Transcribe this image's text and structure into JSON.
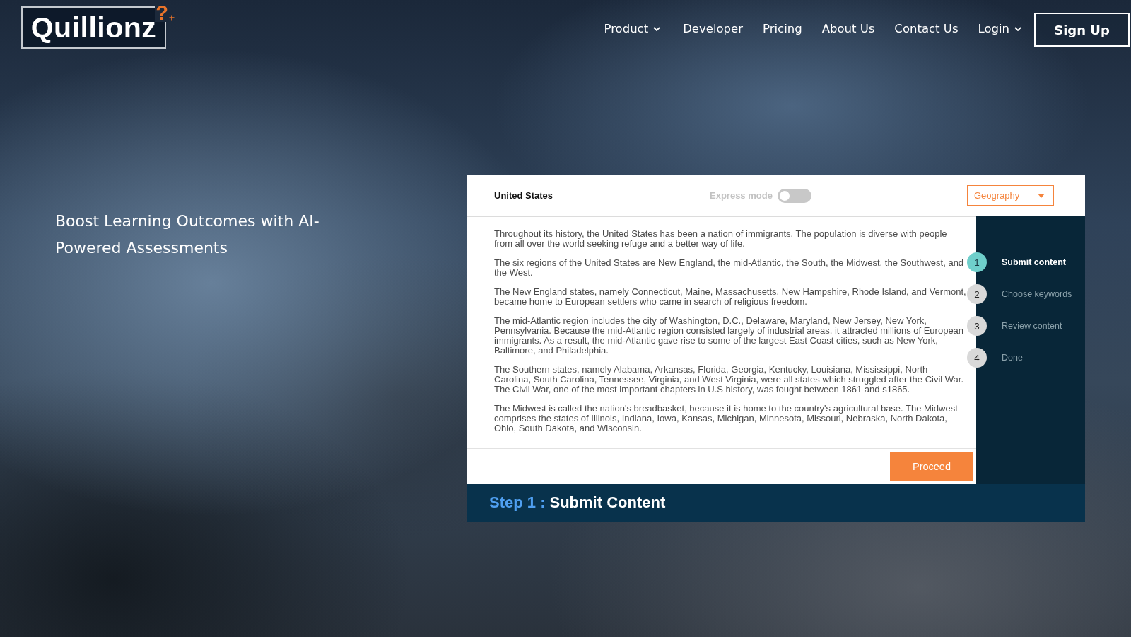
{
  "logo": {
    "wordmark": "Quillionz",
    "mark": "?"
  },
  "nav": {
    "items": [
      {
        "label": "Product",
        "dropdown": true
      },
      {
        "label": "Developer",
        "dropdown": false
      },
      {
        "label": "Pricing",
        "dropdown": false
      },
      {
        "label": "About Us",
        "dropdown": false
      },
      {
        "label": "Contact Us",
        "dropdown": false
      },
      {
        "label": "Login",
        "dropdown": true
      }
    ],
    "signup": "Sign Up"
  },
  "hero": {
    "headline": "Boost Learning Outcomes with AI-Powered Assessments"
  },
  "panel": {
    "header": {
      "title": "United States",
      "express_mode": {
        "label": "Express mode",
        "on": false
      },
      "category": {
        "value": "Geography"
      }
    },
    "paragraphs": [
      "Throughout its history, the United States has been a nation of immigrants. The population is diverse with people from all over the world seeking refuge and a better way of life.",
      "The six regions of the United States are New England, the mid-Atlantic, the South, the Midwest, the Southwest, and the West.",
      "The New England states, namely Connecticut, Maine, Massachusetts, New Hampshire, Rhode Island, and Vermont, became home to European settlers who came in search of religious freedom.",
      "The mid-Atlantic region includes the city of Washington, D.C., Delaware, Maryland, New Jersey, New York, Pennsylvania. Because the mid-Atlantic region consisted largely of industrial areas, it attracted millions of European immigrants. As a result, the mid-Atlantic gave rise to some of the largest East Coast cities, such as New York, Baltimore, and Philadelphia.",
      "The Southern states, namely Alabama, Arkansas, Florida, Georgia, Kentucky, Louisiana, Mississippi, North Carolina, South Carolina, Tennessee, Virginia, and West Virginia, were all states which struggled after the Civil War. The Civil War, one of the most important chapters in U.S history, was fought between 1861 and s1865.",
      "The Midwest is called the nation's breadbasket, because it is home to the country's agricultural base. The Midwest comprises the states of Illinois, Indiana, Iowa, Kansas, Michigan, Minnesota, Missouri, Nebraska, North Dakota, Ohio, South Dakota, and Wisconsin."
    ],
    "proceed": "Proceed",
    "steps": [
      {
        "number": "1",
        "label": "Submit content",
        "selected": true
      },
      {
        "number": "2",
        "label": "Choose keywords",
        "selected": false
      },
      {
        "number": "3",
        "label": "Review content",
        "selected": false
      },
      {
        "number": "4",
        "label": "Done",
        "selected": false
      }
    ],
    "step_banner": {
      "prefix": "Step 1 :",
      "title": "Submit Content"
    }
  }
}
